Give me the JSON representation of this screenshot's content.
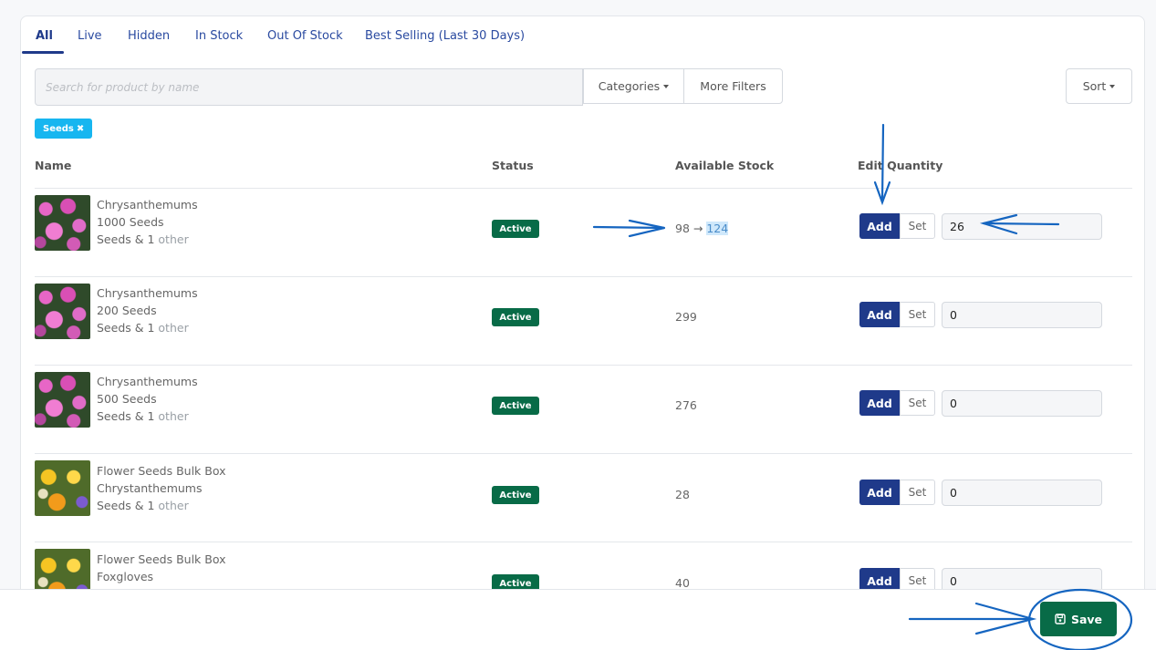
{
  "tabs": [
    "All",
    "Live",
    "Hidden",
    "In Stock",
    "Out Of Stock",
    "Best Selling (Last 30 Days)"
  ],
  "search": {
    "placeholder": "Search for product by name",
    "value": ""
  },
  "filters": {
    "categories_label": "Categories",
    "more_filters_label": "More Filters",
    "sort_label": "Sort"
  },
  "active_filter_chip": "Seeds",
  "table": {
    "headers": {
      "name": "Name",
      "status": "Status",
      "stock": "Available Stock",
      "edit": "Edit Quantity"
    },
    "rows": [
      {
        "title": "Chrysanthemums",
        "variant": "1000 Seeds",
        "category": "Seeds & 1",
        "extra": "other",
        "status": "Active",
        "stock_before": "98",
        "stock_arrow": "→",
        "stock_after": "124",
        "qty": "26",
        "add_label": "Add",
        "set_label": "Set",
        "image": "pink-chrysanthemum-photo"
      },
      {
        "title": "Chrysanthemums",
        "variant": "200 Seeds",
        "category": "Seeds & 1",
        "extra": "other",
        "status": "Active",
        "stock": "299",
        "qty": "0",
        "add_label": "Add",
        "set_label": "Set",
        "image": "pink-chrysanthemum-photo"
      },
      {
        "title": "Chrysanthemums",
        "variant": "500 Seeds",
        "category": "Seeds & 1",
        "extra": "other",
        "status": "Active",
        "stock": "276",
        "qty": "0",
        "add_label": "Add",
        "set_label": "Set",
        "image": "pink-chrysanthemum-photo"
      },
      {
        "title": "Flower Seeds Bulk Box",
        "variant": "Chrystanthemums",
        "category": "Seeds & 1",
        "extra": "other",
        "status": "Active",
        "stock": "28",
        "qty": "0",
        "add_label": "Add",
        "set_label": "Set",
        "image": "mixed-flowers-photo"
      },
      {
        "title": "Flower Seeds Bulk Box",
        "variant": "Foxgloves",
        "category": "",
        "extra": "",
        "status": "Active",
        "stock": "40",
        "qty": "0",
        "add_label": "Add",
        "set_label": "Set",
        "image": "mixed-flowers-photo"
      }
    ]
  },
  "footer": {
    "save_label": "Save"
  },
  "colors": {
    "primary": "#1f3a8a",
    "success": "#086b47",
    "chip": "#17b6f0",
    "annotation": "#1565c0"
  }
}
